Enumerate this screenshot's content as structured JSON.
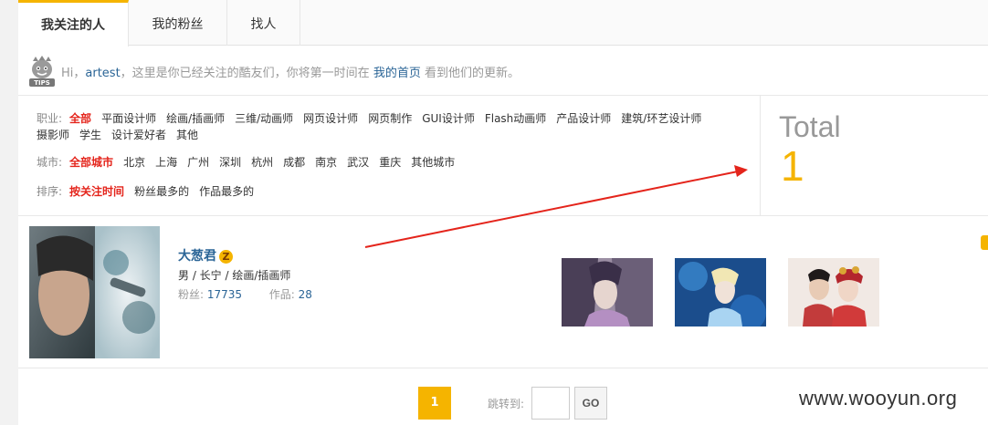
{
  "tabs": [
    {
      "label": "我关注的人",
      "active": true
    },
    {
      "label": "我的粉丝",
      "active": false
    },
    {
      "label": "找人",
      "active": false
    }
  ],
  "tips": {
    "icon_label": "TIPS",
    "greeting": "Hi，",
    "username": "artest",
    "middle_text": "，这里是你已经关注的酷友们，你将第一时间在",
    "link_text": "我的首页",
    "end_text": "看到他们的更新。"
  },
  "filters": {
    "job": {
      "label": "职业:",
      "options": [
        "全部",
        "平面设计师",
        "绘画/插画师",
        "三维/动画师",
        "网页设计师",
        "网页制作",
        "GUI设计师",
        "Flash动画师",
        "产品设计师",
        "建筑/环艺设计师",
        "摄影师",
        "学生",
        "设计爱好者",
        "其他"
      ],
      "selected": "全部"
    },
    "city": {
      "label": "城市:",
      "options": [
        "全部城市",
        "北京",
        "上海",
        "广州",
        "深圳",
        "杭州",
        "成都",
        "南京",
        "武汉",
        "重庆",
        "其他城市"
      ],
      "selected": "全部城市"
    },
    "sort": {
      "label": "排序:",
      "options": [
        "按关注时间",
        "粉丝最多的",
        "作品最多的"
      ],
      "selected": "按关注时间"
    }
  },
  "total": {
    "label": "Total",
    "value": "1"
  },
  "user": {
    "name": "大葱君",
    "badge": "Z",
    "info": "男 / 长宁 / 绘画/插画师",
    "fans_label": "粉丝:",
    "fans": "17735",
    "works_label": "作品:",
    "works": "28"
  },
  "pagination": {
    "current_page": "1",
    "jump_label": "跳转到:",
    "jump_value": "",
    "go_label": "GO"
  },
  "watermark": "www.wooyun.org",
  "colors": {
    "accent": "#f5b400",
    "link": "#2a6496",
    "selected": "#e4241b",
    "arrow": "#e4241b"
  }
}
